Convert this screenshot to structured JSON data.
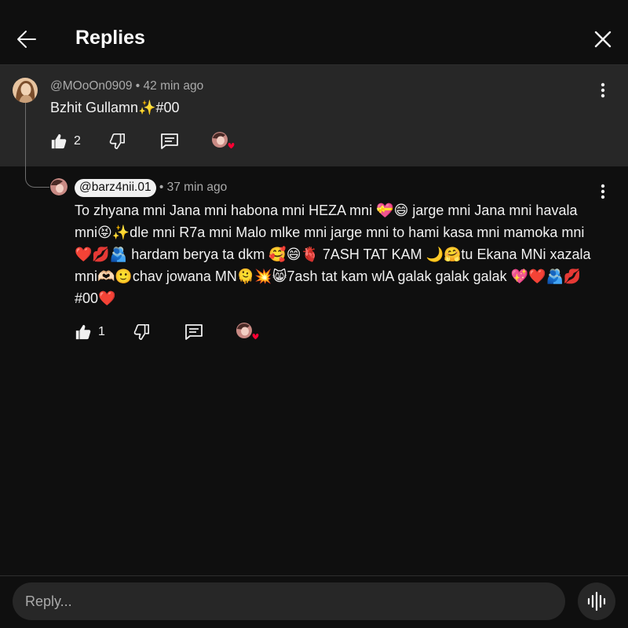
{
  "header": {
    "title": "Replies"
  },
  "parent_comment": {
    "author": "@MOoOn0909",
    "time": " • 42 min ago",
    "text": "Bzhit Gullamn✨#00",
    "likes": "2"
  },
  "reply_comment": {
    "author": "@barz4nii.01",
    "time": " • 37 min ago",
    "text": "To zhyana mni Jana mni habona mni HEZA mni 💝😄 jarge mni Jana mni havala mni😝✨dle mni R7a mni Malo mlke mni jarge mni to hami kasa mni mamoka mni❤️💋🫂 hardam berya ta dkm 🥰😄🫀 7ASH TAT KAM 🌙🤗tu Ekana MNi xazala mni🫶🏻🙂chav jowana MN🫠💥😸7ash tat kam wlA galak galak galak 💖❤️🫂💋#00❤️",
    "likes": "1"
  },
  "footer": {
    "placeholder": "Reply..."
  },
  "icons": {
    "back": "arrow-left-icon",
    "close": "close-icon",
    "more": "more-vert-icon",
    "like": "thumbs-up-icon",
    "dislike": "thumbs-down-icon",
    "reply": "comment-icon",
    "creator_heart": "creator-heart-icon",
    "voice": "voice-search-icon"
  },
  "colors": {
    "background": "#0f0f0f",
    "highlight": "#272727",
    "text": "#f1f1f1",
    "secondary_text": "#aaaaaa",
    "heart": "#ff0033"
  }
}
